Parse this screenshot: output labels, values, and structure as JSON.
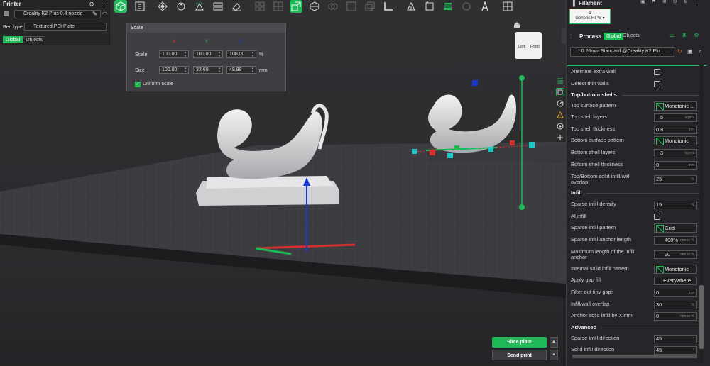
{
  "printer": {
    "title": "Printer",
    "model": "Creality K2 Plus 0.4 nozzle",
    "bed_type_label": "Bed type",
    "bed_type": "Textured PEI Plate",
    "tabs": [
      "Global",
      "Objects"
    ]
  },
  "scale_panel": {
    "title": "Scale",
    "axes": [
      "X",
      "Y",
      "Z"
    ],
    "scale_label": "Scale",
    "size_label": "Size",
    "scale_values": [
      "100.00",
      "100.00",
      "100.00"
    ],
    "scale_unit": "%",
    "size_values": [
      "100.00",
      "33.69",
      "48.89"
    ],
    "size_unit": "mm",
    "uniform_label": "Uniform scale",
    "uniform_checked": true
  },
  "view_cube": {
    "left": "Left",
    "front": "Front"
  },
  "filament": {
    "title": "Filament",
    "slot": "1",
    "name": "Generic HIPS ▾"
  },
  "process": {
    "title": "Process",
    "tabs": [
      "Global",
      "Objects"
    ],
    "profile": "* 0.20mm Standard @Creality K2 Plu..."
  },
  "settings": {
    "alternate_extra_wall": "Alternate extra wall",
    "detect_thin_walls": "Detect thin walls",
    "top_bottom_header": "Top/bottom shells",
    "top_surface_pattern": {
      "label": "Top surface pattern",
      "value": "Monotonic ..."
    },
    "top_shell_layers": {
      "label": "Top shell layers",
      "value": "5",
      "unit": "layers"
    },
    "top_shell_thickness": {
      "label": "Top shell thickness",
      "value": "0.8",
      "unit": "mm"
    },
    "bottom_surface_pattern": {
      "label": "Bottom surface pattern",
      "value": "Monotonic"
    },
    "bottom_shell_layers": {
      "label": "Bottom shell layers",
      "value": "3",
      "unit": "layers"
    },
    "bottom_shell_thickness": {
      "label": "Bottom shell thickness",
      "value": "0",
      "unit": "mm"
    },
    "solid_infill_overlap": {
      "label": "Top/Bottom solid infill/wall overlap",
      "value": "25",
      "unit": "%"
    },
    "infill_header": "Infill",
    "sparse_infill_density": {
      "label": "Sparse infill density",
      "value": "15",
      "unit": "%"
    },
    "ai_infill": "AI infill",
    "sparse_infill_pattern": {
      "label": "Sparse infill pattern",
      "value": "Grid"
    },
    "anchor_length": {
      "label": "Sparse infill anchor length",
      "value": "400%",
      "unit": "mm or %"
    },
    "max_anchor": {
      "label": "Maximum length of the infill anchor",
      "value": "20",
      "unit": "mm or %"
    },
    "internal_solid_pattern": {
      "label": "Internal solid infill pattern",
      "value": "Monotonic"
    },
    "apply_gap_fill": {
      "label": "Apply gap fill",
      "value": "Everywhere"
    },
    "filter_gaps": {
      "label": "Filter out tiny gaps",
      "value": "0",
      "unit": "mm"
    },
    "infill_wall_overlap": {
      "label": "Infill/wall overlap",
      "value": "30",
      "unit": "%"
    },
    "anchor_solid": {
      "label": "Anchor solid infill by X mm",
      "value": "0",
      "unit": "mm or %"
    },
    "advanced_header": "Advanced",
    "sparse_direction": {
      "label": "Sparse infill direction",
      "value": "45",
      "unit": "°"
    },
    "solid_direction": {
      "label": "Solid infill direction",
      "value": "45",
      "unit": "°"
    }
  },
  "actions": {
    "slice": "Slice plate",
    "send": "Send print"
  },
  "colors": {
    "accent": "#1fb958",
    "x_axis": "#d32f2f",
    "y_axis": "#1fb958",
    "z_axis": "#1a36d6"
  }
}
